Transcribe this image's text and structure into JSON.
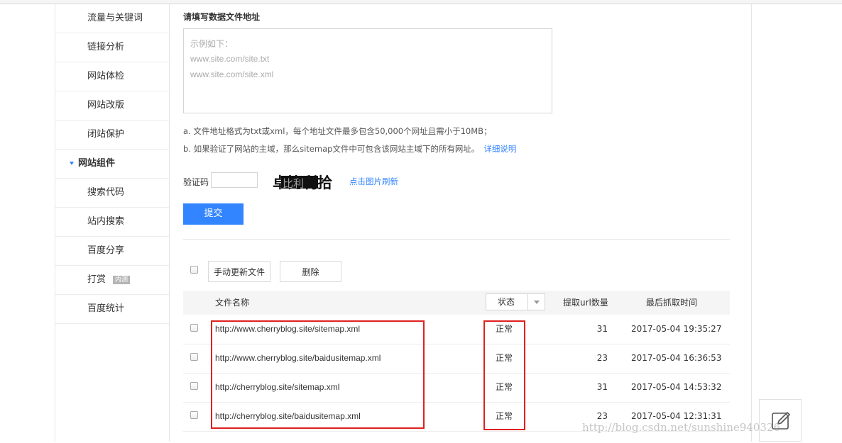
{
  "sidebar": {
    "items": [
      {
        "label": "流量与关键词"
      },
      {
        "label": "链接分析"
      },
      {
        "label": "网站体检"
      },
      {
        "label": "网站改版"
      },
      {
        "label": "闭站保护"
      },
      {
        "label": "网站组件"
      },
      {
        "label": "搜索代码"
      },
      {
        "label": "站内搜索"
      },
      {
        "label": "百度分享"
      },
      {
        "label": "打赏",
        "badge": "内测"
      },
      {
        "label": "百度统计"
      }
    ]
  },
  "form": {
    "title": "请填写数据文件地址",
    "placeholder_lines": [
      "示例如下：",
      "www.site.com/site.txt",
      "www.site.com/site.xml"
    ],
    "note_a": "a. 文件地址格式为txt或xml，每个地址文件最多包含50,000个网址且需小于10MB；",
    "note_b": "b. 如果验证了网站的主域，那么sitemap文件中可包含该网站主域下的所有网址。",
    "note_b_link": "详细说明",
    "captcha_label": "验证码",
    "captcha_text": "卓比利拾",
    "refresh_label": "点击图片刷新",
    "submit_label": "提交"
  },
  "toolbar": {
    "manual_update_label": "手动更新文件",
    "delete_label": "删除"
  },
  "table": {
    "headers": {
      "filename": "文件名称",
      "status": "状态",
      "url_count": "提取url数量",
      "last_crawl": "最后抓取时间"
    },
    "rows": [
      {
        "url": "http://www.cherryblog.site/sitemap.xml",
        "status": "正常",
        "count": "31",
        "time": "2017-05-04 19:35:27"
      },
      {
        "url": "http://www.cherryblog.site/baidusitemap.xml",
        "status": "正常",
        "count": "23",
        "time": "2017-05-04 16:36:53"
      },
      {
        "url": "http://cherryblog.site/sitemap.xml",
        "status": "正常",
        "count": "31",
        "time": "2017-05-04 14:53:32"
      },
      {
        "url": "http://cherryblog.site/baidusitemap.xml",
        "status": "正常",
        "count": "23",
        "time": "2017-05-04 12:31:31"
      }
    ]
  },
  "watermark": "http://blog.csdn.net/sunshine940326",
  "colors": {
    "accent": "#3385ff",
    "highlight": "#e02020"
  },
  "icons": {
    "edit": "pencil-edit-icon"
  }
}
